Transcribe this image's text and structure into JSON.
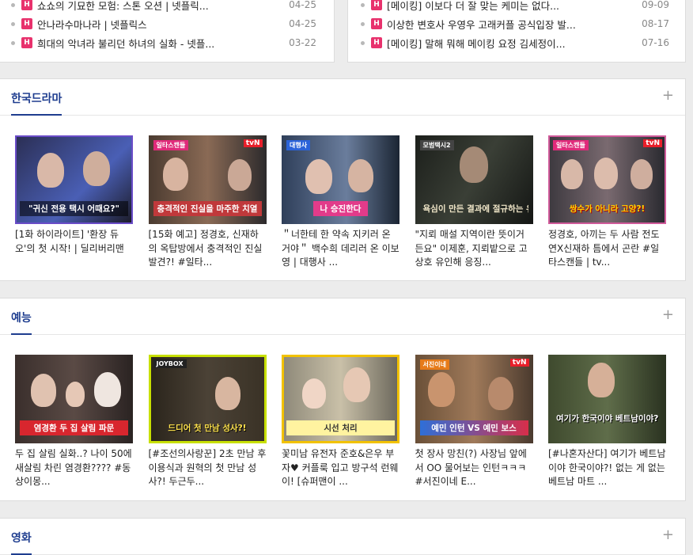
{
  "top_news": {
    "left": [
      {
        "badge": "H",
        "title": "쇼쇼의 기묘한 모험: 스톤 오션 | 넷플릭...",
        "date": "04-25"
      },
      {
        "badge": "H",
        "title": "안나라수마나라 | 넷플릭스",
        "date": "04-25"
      },
      {
        "badge": "H",
        "title": "희대의 악녀라 불리던 하녀의 실화 - 넷플...",
        "date": "03-22"
      }
    ],
    "right": [
      {
        "badge": "H",
        "title": "[메이킹] 이보다 더 잘 맞는 케미는 없다...",
        "date": "09-09"
      },
      {
        "badge": "H",
        "title": "이상한 변호사 우영우 고래커플 공식입장 발...",
        "date": "08-17"
      },
      {
        "badge": "H",
        "title": "[메이킹] 말해 뭐해 메이킹 요정 김세정이...",
        "date": "07-16"
      }
    ]
  },
  "sections": [
    {
      "title": "한국드라마",
      "more": "+",
      "cards": [
        {
          "title": "[1화 하이라이트] '환장 듀오'의 첫 시작! | 딜리버리맨",
          "thumb_caption": "\"귀신 전용 택시 어때요?\"",
          "thumb_tag": "",
          "thumb_logo": "",
          "theme": "#4a5fb5"
        },
        {
          "title": "[15화 예고] 정경호, 신재하의 옥탑방에서 충격적인 진실 발견?! #일타...",
          "thumb_caption": "충격적인 진실을 마주한 치열",
          "thumb_tag": "일타스캔들",
          "thumb_logo": "tvN",
          "theme": "#8a6a55"
        },
        {
          "title": "＂너한테 한 약속 지키러 온 거야＂ 백수희 데리러 온 이보영 | 대행사 ...",
          "thumb_caption": "나 승진한다",
          "thumb_tag": "대행사",
          "thumb_logo": "",
          "theme": "#6a7d9c"
        },
        {
          "title": "\"지뢰 매설 지역이란 뜻이거든요\" 이제훈, 지뢰밭으로 고상호 유인해 응징...",
          "thumb_caption": "욕심이 만든 결과에 절규하는 유상하",
          "thumb_tag": "모범택시2",
          "thumb_logo": "",
          "theme": "#3a3f36"
        },
        {
          "title": "정경호, 아끼는 두 사람 전도연X신재하 틈에서 곤란 #일타스캔들 | tv...",
          "thumb_caption": "쌍수가 아니라 고양?!",
          "thumb_tag": "일타스캔들",
          "thumb_logo": "tvN",
          "theme": "#7a6a70"
        }
      ]
    },
    {
      "title": "예능",
      "more": "+",
      "cards": [
        {
          "title": "두 집 살림 실화..? 나이 50에 새살림 차린 염경환???? #동상이몽...",
          "thumb_caption": "염경환 두 집 살림 파문",
          "thumb_tag": "",
          "thumb_logo": "",
          "theme": "#5a4a45"
        },
        {
          "title": "[#조선의사랑꾼] 2초 만남 후 이용식과 원혁의 첫 만남 성사?! 두근두...",
          "thumb_caption": "드디어 첫 만남 성사?!",
          "thumb_tag": "JOYBOX",
          "thumb_logo": "",
          "theme": "#4b4236"
        },
        {
          "title": "꽃미남 유전자 준호&은우 부자♥ 커플룩 입고 방구석 런웨이! [슈퍼맨이 ...",
          "thumb_caption": "시선 처리",
          "thumb_tag": "",
          "thumb_logo": "",
          "theme": "#c9c0a8"
        },
        {
          "title": "첫 장사 망친(?) 사장님 앞에서 OO 물어보는 인턴ㅋㅋㅋ #서진이네 E...",
          "thumb_caption": "예민 인턴 VS 예민 보스",
          "thumb_tag": "서진이네",
          "thumb_logo": "tvN",
          "theme": "#a07a5a"
        },
        {
          "title": "[#나혼자산다] 여기가 베트남이야 한국이야?! 없는 게 없는 베트남 마트 ...",
          "thumb_caption": "여기가 한국이야 베트남이야?",
          "thumb_tag": "",
          "thumb_logo": "",
          "theme": "#5f6d4a"
        }
      ]
    },
    {
      "title": "영화",
      "more": "+",
      "cards": []
    }
  ]
}
